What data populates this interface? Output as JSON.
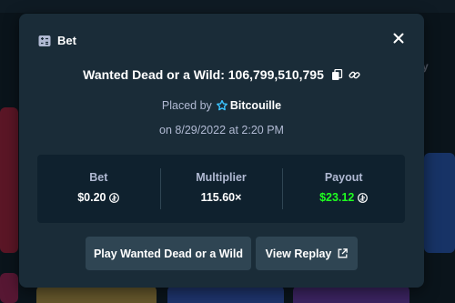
{
  "modal": {
    "title": "Bet",
    "title_icon": "bet-ticket-icon",
    "close_icon": "close-icon"
  },
  "bet": {
    "game": "Wanted Dead or a Wild",
    "separator": ": ",
    "bet_id": "106,799,510,795",
    "placed_by_label": "Placed by",
    "user": "Bitcouille",
    "date": "on 8/29/2022 at 2:20 PM"
  },
  "stats": [
    {
      "label": "Bet",
      "value": "$0.20",
      "coin": true
    },
    {
      "label": "Multiplier",
      "value": "115.60×",
      "coin": false
    },
    {
      "label": "Payout",
      "value": "$23.12",
      "coin": true
    }
  ],
  "buttons": {
    "play": "Play Wanted Dead or a Wild",
    "replay": "View Replay"
  },
  "background": {
    "right_hint": "y"
  },
  "colors": {
    "modal_bg": "#1a2c38",
    "panel_bg": "#0f212e",
    "button_bg": "#2f4553",
    "muted_text": "#b1bad3",
    "payout_green": "#1fff20",
    "user_badge": "#3bc3ff"
  }
}
